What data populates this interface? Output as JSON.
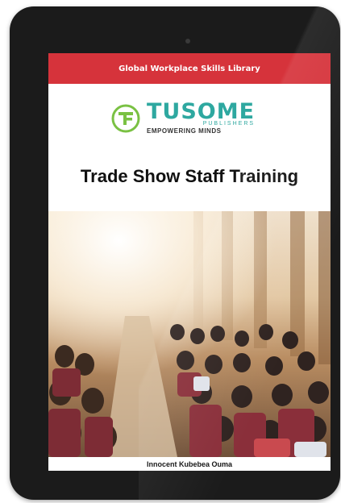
{
  "cover": {
    "library_label": "Global Workplace Skills Library",
    "publisher_name": "TUSOME",
    "publisher_sub": "PUBLISHERS",
    "publisher_tagline": "EMPOWERING MINDS",
    "title": "Trade Show Staff Training",
    "author": "Innocent Kubebea Ouma"
  },
  "colors": {
    "header_red": "#d6333b",
    "brand_teal": "#2ea8a0",
    "tablet_bezel": "#1b1b1b"
  },
  "icons": {
    "logo": "tusome-logo-icon",
    "camera": "front-camera-icon"
  }
}
